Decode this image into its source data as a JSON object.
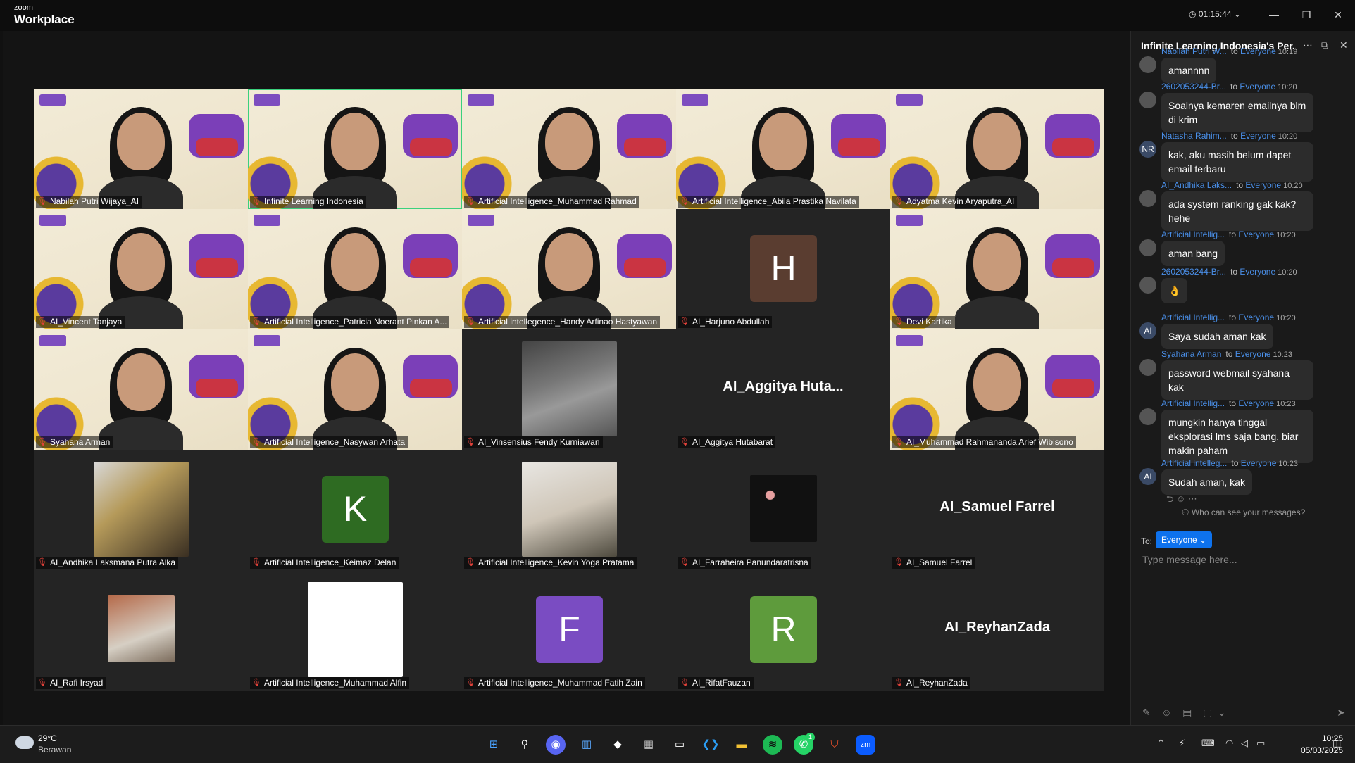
{
  "app": {
    "brand_small": "zoom",
    "brand_big": "Workplace",
    "timer": "01:15:44",
    "window_controls": {
      "minimize": "—",
      "restore": "❐",
      "close": "✕"
    }
  },
  "participants": [
    {
      "name": "Nabilah Putri Wijaya_AI",
      "kind": "banner"
    },
    {
      "name": "Infinite Learning Indonesia",
      "kind": "banner",
      "active": true
    },
    {
      "name": "Artificial Intelligence_Muhammad Rahmad",
      "kind": "banner"
    },
    {
      "name": "Artificial Intelligence_Abila Prastika Navilata",
      "kind": "banner"
    },
    {
      "name": "Adyatma Kevin Aryaputra_AI",
      "kind": "banner"
    },
    {
      "name": "AI_Vincent Tanjaya",
      "kind": "banner"
    },
    {
      "name": "Artificial Intelligence_Patricia Noerant Pinkan A...",
      "kind": "banner"
    },
    {
      "name": "Artificial intellegence_Handy Arfinao Hastyawan",
      "kind": "banner"
    },
    {
      "name": "AI_Harjuno Abdullah",
      "kind": "letter",
      "letter": "H",
      "color": "#5a3d30"
    },
    {
      "name": "Devi Kartika",
      "kind": "banner"
    },
    {
      "name": "Syahana Arman",
      "kind": "banner"
    },
    {
      "name": "Artificial Intelligence_Nasywan Arhata",
      "kind": "banner"
    },
    {
      "name": "AI_Vinsensius Fendy Kurniawan",
      "kind": "photo"
    },
    {
      "name": "AI_Aggitya Hutabarat",
      "kind": "text",
      "display": "AI_Aggitya  Huta..."
    },
    {
      "name": "AI_Muhammad Rahmananda Arief Wibisono",
      "kind": "banner"
    },
    {
      "name": "AI_Andhika Laksmana Putra Alka",
      "kind": "photo"
    },
    {
      "name": "Artificial Intelligence_Keimaz Delan",
      "kind": "letter",
      "letter": "K",
      "color": "#2e6b22"
    },
    {
      "name": "Artificial Intelligence_Kevin Yoga Pratama",
      "kind": "photo"
    },
    {
      "name": "AI_Farraheira Panundaratrisna",
      "kind": "photo"
    },
    {
      "name": "AI_Samuel Farrel",
      "kind": "text",
      "display": "AI_Samuel Farrel"
    },
    {
      "name": "AI_Rafi Irsyad",
      "kind": "photo"
    },
    {
      "name": "Artificial Intelligence_Muhammad Alfin",
      "kind": "photo"
    },
    {
      "name": "Artificial Intelligence_Muhammad Fatih Zain",
      "kind": "letter",
      "letter": "F",
      "color": "#7a4cc2"
    },
    {
      "name": "AI_RifatFauzan",
      "kind": "letter",
      "letter": "R",
      "color": "#5e9b3c"
    },
    {
      "name": "AI_ReyhanZada",
      "kind": "text",
      "display": "AI_ReyhanZada"
    }
  ],
  "chat": {
    "title": "Infinite Learning Indonesia's Per...",
    "to_word": "to",
    "everyone_word": "Everyone",
    "messages": [
      {
        "sender": "Nabilah Putri W...",
        "time": "10:19",
        "text": "amannnn",
        "avatar": ""
      },
      {
        "sender": "2602053244-Br...",
        "time": "10:20",
        "text": "Soalnya kemaren emailnya blm di krim",
        "avatar": ""
      },
      {
        "sender": "Natasha Rahim...",
        "time": "10:20",
        "text": "kak, aku masih belum dapet email terbaru",
        "avatar": "NR"
      },
      {
        "sender": "AI_Andhika Laks...",
        "time": "10:20",
        "text": "ada system ranking gak kak? hehe",
        "avatar": ""
      },
      {
        "sender": "Artificial Intellig...",
        "time": "10:20",
        "text": "aman bang",
        "avatar": ""
      },
      {
        "sender": "2602053244-Br...",
        "time": "10:20",
        "text": "👌",
        "avatar": ""
      },
      {
        "sender": "Artificial Intellig...",
        "time": "10:20",
        "text": "Saya sudah aman kak",
        "avatar": "AI"
      },
      {
        "sender": "Syahana Arman",
        "time": "10:23",
        "text": "password webmail syahana kak",
        "avatar": ""
      },
      {
        "sender": "Artificial Intellig...",
        "time": "10:23",
        "text": "mungkin hanya tinggal eksplorasi lms saja bang, biar makin paham",
        "avatar": ""
      },
      {
        "sender": "Artificial intelleg...",
        "time": "10:23",
        "text": "Sudah aman, kak",
        "avatar": "AI"
      }
    ],
    "who_can_see": "Who can see your messages?",
    "to_label": "To:",
    "to_value": "Everyone",
    "input_placeholder": "Type message here..."
  },
  "taskbar": {
    "temp": "29°C",
    "weather": "Berawan",
    "whatsapp_badge": "1",
    "time": "10:25",
    "date": "05/03/2025"
  }
}
